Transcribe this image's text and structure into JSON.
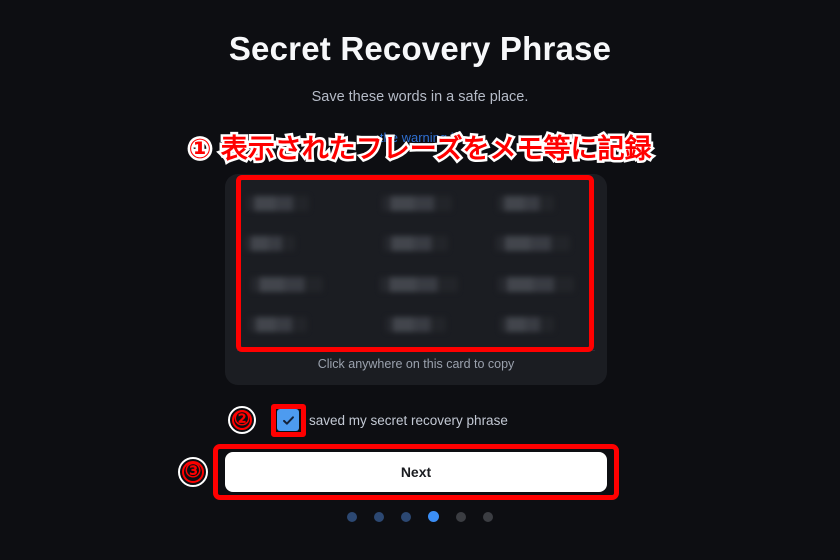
{
  "page": {
    "title": "Secret Recovery Phrase",
    "subtitle": "Save these words in a safe place.",
    "warning_link": "the warning is"
  },
  "phrase_card": {
    "footer": "Click anywhere on this card to copy",
    "words_hidden": true,
    "columns": 3,
    "rows": 4,
    "cells": [
      {
        "redacted": true
      },
      {
        "redacted": true
      },
      {
        "redacted": true
      },
      {
        "redacted": true
      },
      {
        "redacted": true
      },
      {
        "redacted": true
      },
      {
        "redacted": true
      },
      {
        "redacted": true
      },
      {
        "redacted": true
      },
      {
        "redacted": true
      },
      {
        "redacted": true
      },
      {
        "redacted": true
      }
    ]
  },
  "confirm": {
    "checkbox_checked": true,
    "label": "saved my secret recovery phrase"
  },
  "actions": {
    "next_label": "Next"
  },
  "pagination": {
    "total": 6,
    "active_index": 4,
    "states": [
      "done",
      "done",
      "done",
      "active",
      "upcoming",
      "upcoming"
    ]
  },
  "annotations": {
    "step1_text": "① 表示されたフレーズをメモ等に記録",
    "step2_marker": "②",
    "step3_marker": "③",
    "highlight_color": "#ff0000"
  },
  "colors": {
    "background": "#0d0e12",
    "card": "#1b1d22",
    "accent_blue": "#3b8ef5",
    "checkbox_blue": "#4d9bf0",
    "button_white": "#ffffff",
    "annotation_red": "#ff0000"
  }
}
